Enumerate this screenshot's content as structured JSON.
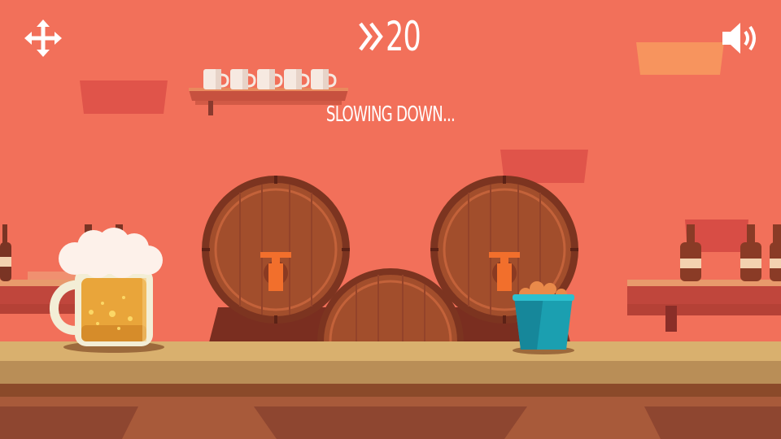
{
  "hud": {
    "speed_value": "20",
    "status_text": "SLOWING DOWN...",
    "move_icon": "move-arrows-icon",
    "sound_icon": "speaker-sound-on-icon",
    "speed_icon": "double-chevron-right-icon"
  },
  "scene": {
    "items": [
      "beer-mug",
      "wine-barrel",
      "wine-barrel",
      "wine-barrel",
      "peanut-bucket",
      "mug-shelf",
      "bottle-shelf-left",
      "bottle-shelf-right"
    ],
    "shelf_mug_count": 5
  },
  "colors": {
    "background": "#f2705a",
    "wall_panel": "#e0544a",
    "counter_top": "#d9b06e",
    "counter_front": "#a85a3a",
    "barrel_wood": "#a24e2c",
    "tap": "#f26f2c",
    "beer": "#e9a53a",
    "bucket": "#1b9fb0",
    "hud_text": "#ffffff"
  }
}
